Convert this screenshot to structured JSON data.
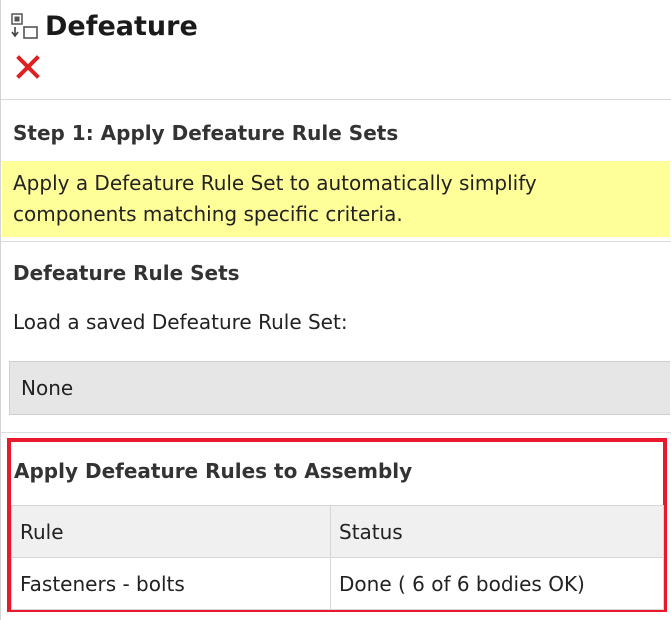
{
  "header": {
    "icon": "defeature-feature-icon",
    "title": "Defeature",
    "close_icon": "close-x-icon",
    "close_color": "#e02020"
  },
  "step1": {
    "title": "Step 1: Apply Defeature Rule Sets",
    "hint_lines": [
      "Apply a Defeature Rule Set to automatically simplify",
      "components matching specific criteria."
    ],
    "hint_background": "#ffff99"
  },
  "rule_sets": {
    "title": "Defeature Rule Sets",
    "load_label": "Load a saved Defeature Rule Set:",
    "selected_value": "None"
  },
  "assembly": {
    "title": "Apply Defeature Rules to Assembly",
    "highlight_color": "#e8192c",
    "columns": [
      "Rule",
      "Status"
    ],
    "rows": [
      [
        "Fasteners - bolts",
        "Done ( 6 of  6 bodies OK)"
      ]
    ]
  }
}
